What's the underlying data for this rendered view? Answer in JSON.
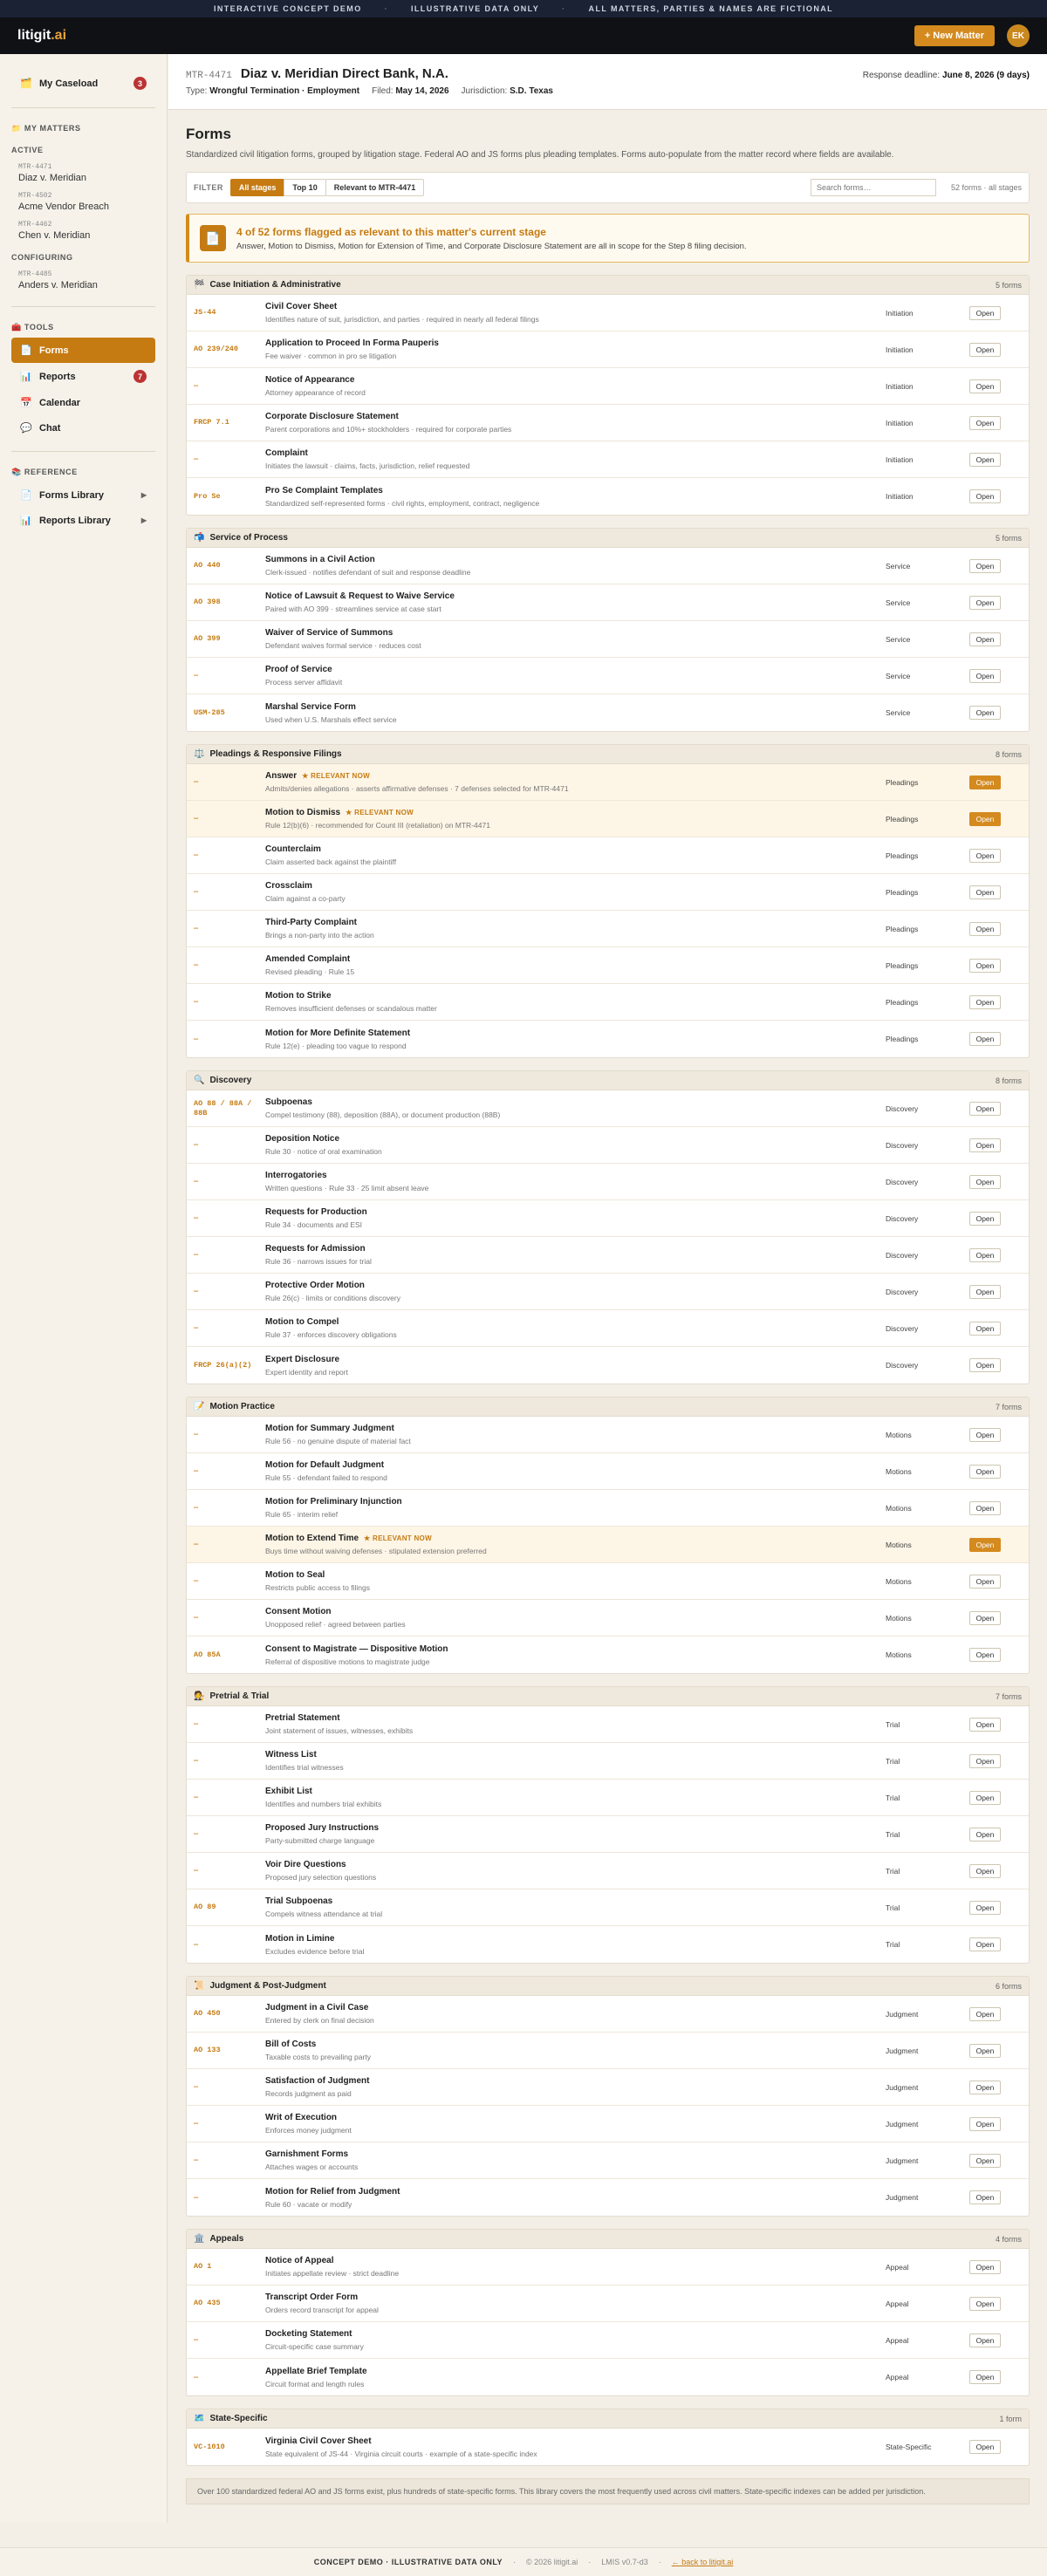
{
  "banner": [
    "INTERACTIVE CONCEPT DEMO",
    "ILLUSTRATIVE DATA ONLY",
    "ALL MATTERS, PARTIES & NAMES ARE FICTIONAL"
  ],
  "header": {
    "logo_main": "litigit",
    "logo_suffix": ".ai",
    "new_matter": "+ New Matter",
    "avatar": "EK"
  },
  "sidebar": {
    "caseload_label": "My Caseload",
    "caseload_count": "3",
    "my_matters": "MY MATTERS",
    "active_label": "ACTIVE",
    "active_matters": [
      {
        "code": "MTR-4471",
        "name": "Diaz v. Meridian"
      },
      {
        "code": "MTR-4502",
        "name": "Acme Vendor Breach"
      },
      {
        "code": "MTR-4462",
        "name": "Chen v. Meridian"
      }
    ],
    "configuring_label": "CONFIGURING",
    "configuring_matters": [
      {
        "code": "MTR-4485",
        "name": "Anders v. Meridian"
      }
    ],
    "tools_label": "TOOLS",
    "tools": [
      {
        "label": "Forms",
        "icon": "📄",
        "badge": ""
      },
      {
        "label": "Reports",
        "icon": "📊",
        "badge": "7"
      },
      {
        "label": "Calendar",
        "icon": "📅",
        "badge": ""
      },
      {
        "label": "Chat",
        "icon": "💬",
        "badge": ""
      }
    ],
    "reference_label": "REFERENCE",
    "reference": [
      {
        "label": "Forms Library",
        "icon": "📄"
      },
      {
        "label": "Reports Library",
        "icon": "📊"
      }
    ]
  },
  "matter": {
    "code": "MTR-4471",
    "title": "Diaz v. Meridian Direct Bank, N.A.",
    "deadline_label": "Response deadline:",
    "deadline": "June 8, 2026 (9 days)",
    "type_label": "Type:",
    "type": "Wrongful Termination · Employment",
    "filed_label": "Filed:",
    "filed": "May 14, 2026",
    "jurisdiction_label": "Jurisdiction:",
    "jurisdiction": "S.D. Texas"
  },
  "page": {
    "title": "Forms",
    "description": "Standardized civil litigation forms, grouped by litigation stage. Federal AO and JS forms plus pleading templates. Forms auto-populate from the matter record where fields are available."
  },
  "filter": {
    "label": "FILTER",
    "chips": [
      "All stages",
      "Top 10",
      "Relevant to MTR-4471"
    ],
    "search_placeholder": "Search forms…",
    "count": "52 forms · all stages"
  },
  "callout": {
    "title": "4 of 52 forms flagged as relevant to this matter's current stage",
    "body": "Answer, Motion to Dismiss, Motion for Extension of Time, and Corporate Disclosure Statement are all in scope for the Step 8 filing decision."
  },
  "relevant_tag": "★ RELEVANT NOW",
  "open_label": "Open",
  "groups": [
    {
      "icon": "🏁",
      "title": "Case Initiation & Administrative",
      "count": "5 forms",
      "rows": [
        {
          "code": "JS-44",
          "title": "Civil Cover Sheet",
          "desc": "Identifies nature of suit, jurisdiction, and parties · required in nearly all federal filings",
          "stage": "Initiation",
          "relevant": false
        },
        {
          "code": "AO 239/240",
          "title": "Application to Proceed In Forma Pauperis",
          "desc": "Fee waiver · common in pro se litigation",
          "stage": "Initiation",
          "relevant": false
        },
        {
          "code": "—",
          "title": "Notice of Appearance",
          "desc": "Attorney appearance of record",
          "stage": "Initiation",
          "relevant": false
        },
        {
          "code": "FRCP 7.1",
          "title": "Corporate Disclosure Statement",
          "desc": "Parent corporations and 10%+ stockholders · required for corporate parties",
          "stage": "Initiation",
          "relevant": false
        },
        {
          "code": "—",
          "title": "Complaint",
          "desc": "Initiates the lawsuit · claims, facts, jurisdiction, relief requested",
          "stage": "Initiation",
          "relevant": false
        },
        {
          "code": "Pro Se",
          "title": "Pro Se Complaint Templates",
          "desc": "Standardized self-represented forms · civil rights, employment, contract, negligence",
          "stage": "Initiation",
          "relevant": false
        }
      ]
    },
    {
      "icon": "📬",
      "title": "Service of Process",
      "count": "5 forms",
      "rows": [
        {
          "code": "AO 440",
          "title": "Summons in a Civil Action",
          "desc": "Clerk-issued · notifies defendant of suit and response deadline",
          "stage": "Service",
          "relevant": false
        },
        {
          "code": "AO 398",
          "title": "Notice of Lawsuit & Request to Waive Service",
          "desc": "Paired with AO 399 · streamlines service at case start",
          "stage": "Service",
          "relevant": false
        },
        {
          "code": "AO 399",
          "title": "Waiver of Service of Summons",
          "desc": "Defendant waives formal service · reduces cost",
          "stage": "Service",
          "relevant": false
        },
        {
          "code": "—",
          "title": "Proof of Service",
          "desc": "Process server affidavit",
          "stage": "Service",
          "relevant": false
        },
        {
          "code": "USM-285",
          "title": "Marshal Service Form",
          "desc": "Used when U.S. Marshals effect service",
          "stage": "Service",
          "relevant": false
        }
      ]
    },
    {
      "icon": "⚖️",
      "title": "Pleadings & Responsive Filings",
      "count": "8 forms",
      "rows": [
        {
          "code": "—",
          "title": "Answer",
          "desc": "Admits/denies allegations · asserts affirmative defenses · 7 defenses selected for MTR-4471",
          "stage": "Pleadings",
          "relevant": true
        },
        {
          "code": "—",
          "title": "Motion to Dismiss",
          "desc": "Rule 12(b)(6) · recommended for Count III (retaliation) on MTR-4471",
          "stage": "Pleadings",
          "relevant": true
        },
        {
          "code": "—",
          "title": "Counterclaim",
          "desc": "Claim asserted back against the plaintiff",
          "stage": "Pleadings",
          "relevant": false
        },
        {
          "code": "—",
          "title": "Crossclaim",
          "desc": "Claim against a co-party",
          "stage": "Pleadings",
          "relevant": false
        },
        {
          "code": "—",
          "title": "Third-Party Complaint",
          "desc": "Brings a non-party into the action",
          "stage": "Pleadings",
          "relevant": false
        },
        {
          "code": "—",
          "title": "Amended Complaint",
          "desc": "Revised pleading · Rule 15",
          "stage": "Pleadings",
          "relevant": false
        },
        {
          "code": "—",
          "title": "Motion to Strike",
          "desc": "Removes insufficient defenses or scandalous matter",
          "stage": "Pleadings",
          "relevant": false
        },
        {
          "code": "—",
          "title": "Motion for More Definite Statement",
          "desc": "Rule 12(e) · pleading too vague to respond",
          "stage": "Pleadings",
          "relevant": false
        }
      ]
    },
    {
      "icon": "🔍",
      "title": "Discovery",
      "count": "8 forms",
      "rows": [
        {
          "code": "AO 88 / 88A / 88B",
          "title": "Subpoenas",
          "desc": "Compel testimony (88), deposition (88A), or document production (88B)",
          "stage": "Discovery",
          "relevant": false
        },
        {
          "code": "—",
          "title": "Deposition Notice",
          "desc": "Rule 30 · notice of oral examination",
          "stage": "Discovery",
          "relevant": false
        },
        {
          "code": "—",
          "title": "Interrogatories",
          "desc": "Written questions · Rule 33 · 25 limit absent leave",
          "stage": "Discovery",
          "relevant": false
        },
        {
          "code": "—",
          "title": "Requests for Production",
          "desc": "Rule 34 · documents and ESI",
          "stage": "Discovery",
          "relevant": false
        },
        {
          "code": "—",
          "title": "Requests for Admission",
          "desc": "Rule 36 · narrows issues for trial",
          "stage": "Discovery",
          "relevant": false
        },
        {
          "code": "—",
          "title": "Protective Order Motion",
          "desc": "Rule 26(c) · limits or conditions discovery",
          "stage": "Discovery",
          "relevant": false
        },
        {
          "code": "—",
          "title": "Motion to Compel",
          "desc": "Rule 37 · enforces discovery obligations",
          "stage": "Discovery",
          "relevant": false
        },
        {
          "code": "FRCP 26(a)(2)",
          "title": "Expert Disclosure",
          "desc": "Expert identity and report",
          "stage": "Discovery",
          "relevant": false
        }
      ]
    },
    {
      "icon": "📝",
      "title": "Motion Practice",
      "count": "7 forms",
      "rows": [
        {
          "code": "—",
          "title": "Motion for Summary Judgment",
          "desc": "Rule 56 · no genuine dispute of material fact",
          "stage": "Motions",
          "relevant": false
        },
        {
          "code": "—",
          "title": "Motion for Default Judgment",
          "desc": "Rule 55 · defendant failed to respond",
          "stage": "Motions",
          "relevant": false
        },
        {
          "code": "—",
          "title": "Motion for Preliminary Injunction",
          "desc": "Rule 65 · interim relief",
          "stage": "Motions",
          "relevant": false
        },
        {
          "code": "—",
          "title": "Motion to Extend Time",
          "desc": "Buys time without waiving defenses · stipulated extension preferred",
          "stage": "Motions",
          "relevant": true
        },
        {
          "code": "—",
          "title": "Motion to Seal",
          "desc": "Restricts public access to filings",
          "stage": "Motions",
          "relevant": false
        },
        {
          "code": "—",
          "title": "Consent Motion",
          "desc": "Unopposed relief · agreed between parties",
          "stage": "Motions",
          "relevant": false
        },
        {
          "code": "AO 85A",
          "title": "Consent to Magistrate — Dispositive Motion",
          "desc": "Referral of dispositive motions to magistrate judge",
          "stage": "Motions",
          "relevant": false
        }
      ]
    },
    {
      "icon": "🧑‍⚖️",
      "title": "Pretrial & Trial",
      "count": "7 forms",
      "rows": [
        {
          "code": "—",
          "title": "Pretrial Statement",
          "desc": "Joint statement of issues, witnesses, exhibits",
          "stage": "Trial",
          "relevant": false
        },
        {
          "code": "—",
          "title": "Witness List",
          "desc": "Identifies trial witnesses",
          "stage": "Trial",
          "relevant": false
        },
        {
          "code": "—",
          "title": "Exhibit List",
          "desc": "Identifies and numbers trial exhibits",
          "stage": "Trial",
          "relevant": false
        },
        {
          "code": "—",
          "title": "Proposed Jury Instructions",
          "desc": "Party-submitted charge language",
          "stage": "Trial",
          "relevant": false
        },
        {
          "code": "—",
          "title": "Voir Dire Questions",
          "desc": "Proposed jury selection questions",
          "stage": "Trial",
          "relevant": false
        },
        {
          "code": "AO 89",
          "title": "Trial Subpoenas",
          "desc": "Compels witness attendance at trial",
          "stage": "Trial",
          "relevant": false
        },
        {
          "code": "—",
          "title": "Motion in Limine",
          "desc": "Excludes evidence before trial",
          "stage": "Trial",
          "relevant": false
        }
      ]
    },
    {
      "icon": "📜",
      "title": "Judgment & Post-Judgment",
      "count": "6 forms",
      "rows": [
        {
          "code": "AO 450",
          "title": "Judgment in a Civil Case",
          "desc": "Entered by clerk on final decision",
          "stage": "Judgment",
          "relevant": false
        },
        {
          "code": "AO 133",
          "title": "Bill of Costs",
          "desc": "Taxable costs to prevailing party",
          "stage": "Judgment",
          "relevant": false
        },
        {
          "code": "—",
          "title": "Satisfaction of Judgment",
          "desc": "Records judgment as paid",
          "stage": "Judgment",
          "relevant": false
        },
        {
          "code": "—",
          "title": "Writ of Execution",
          "desc": "Enforces money judgment",
          "stage": "Judgment",
          "relevant": false
        },
        {
          "code": "—",
          "title": "Garnishment Forms",
          "desc": "Attaches wages or accounts",
          "stage": "Judgment",
          "relevant": false
        },
        {
          "code": "—",
          "title": "Motion for Relief from Judgment",
          "desc": "Rule 60 · vacate or modify",
          "stage": "Judgment",
          "relevant": false
        }
      ]
    },
    {
      "icon": "🏛️",
      "title": "Appeals",
      "count": "4 forms",
      "rows": [
        {
          "code": "AO 1",
          "title": "Notice of Appeal",
          "desc": "Initiates appellate review · strict deadline",
          "stage": "Appeal",
          "relevant": false
        },
        {
          "code": "AO 435",
          "title": "Transcript Order Form",
          "desc": "Orders record transcript for appeal",
          "stage": "Appeal",
          "relevant": false
        },
        {
          "code": "—",
          "title": "Docketing Statement",
          "desc": "Circuit-specific case summary",
          "stage": "Appeal",
          "relevant": false
        },
        {
          "code": "—",
          "title": "Appellate Brief Template",
          "desc": "Circuit format and length rules",
          "stage": "Appeal",
          "relevant": false
        }
      ]
    },
    {
      "icon": "🗺️",
      "title": "State-Specific",
      "count": "1 form",
      "rows": [
        {
          "code": "VC-1010",
          "title": "Virginia Civil Cover Sheet",
          "desc": "State equivalent of JS-44 · Virginia circuit courts · example of a state-specific index",
          "stage": "State-Specific",
          "relevant": false
        }
      ]
    }
  ],
  "footnote": "Over 100 standardized federal AO and JS forms exist, plus hundreds of state-specific forms. This library covers the most frequently used across civil matters. State-specific indexes can be added per jurisdiction.",
  "footer": {
    "demo": "CONCEPT DEMO · ILLUSTRATIVE DATA ONLY",
    "copyright": "© 2026 litigit.ai",
    "version": "LMIS v0.7-d3",
    "back": "← back to litigit.ai"
  }
}
